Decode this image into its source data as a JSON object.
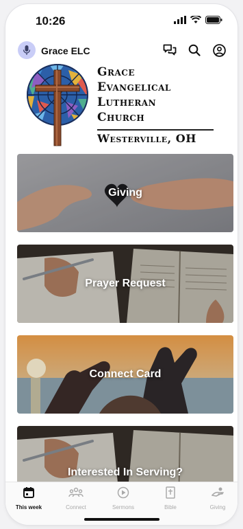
{
  "status": {
    "time": "10:26"
  },
  "app": {
    "name": "Grace ELC"
  },
  "logo": {
    "lines": [
      "Grace",
      "Evangelical",
      "Lutheran",
      "Church"
    ],
    "city": "Westerville, OH"
  },
  "cards": [
    {
      "label": "Giving"
    },
    {
      "label": "Prayer Request"
    },
    {
      "label": "Connect Card"
    },
    {
      "label": "Interested In Serving?"
    }
  ],
  "tabs": [
    {
      "label": "This week",
      "icon": "calendar-icon",
      "active": true
    },
    {
      "label": "Connect",
      "icon": "people-icon",
      "active": false
    },
    {
      "label": "Sermons",
      "icon": "play-icon",
      "active": false
    },
    {
      "label": "Bible",
      "icon": "bible-icon",
      "active": false
    },
    {
      "label": "Giving",
      "icon": "giving-hand-icon",
      "active": false
    }
  ],
  "colors": {
    "avatar_bg": "#c9cdf7",
    "accent_brown": "#8b4a2b",
    "glass_blue": "#2c5fa8"
  }
}
